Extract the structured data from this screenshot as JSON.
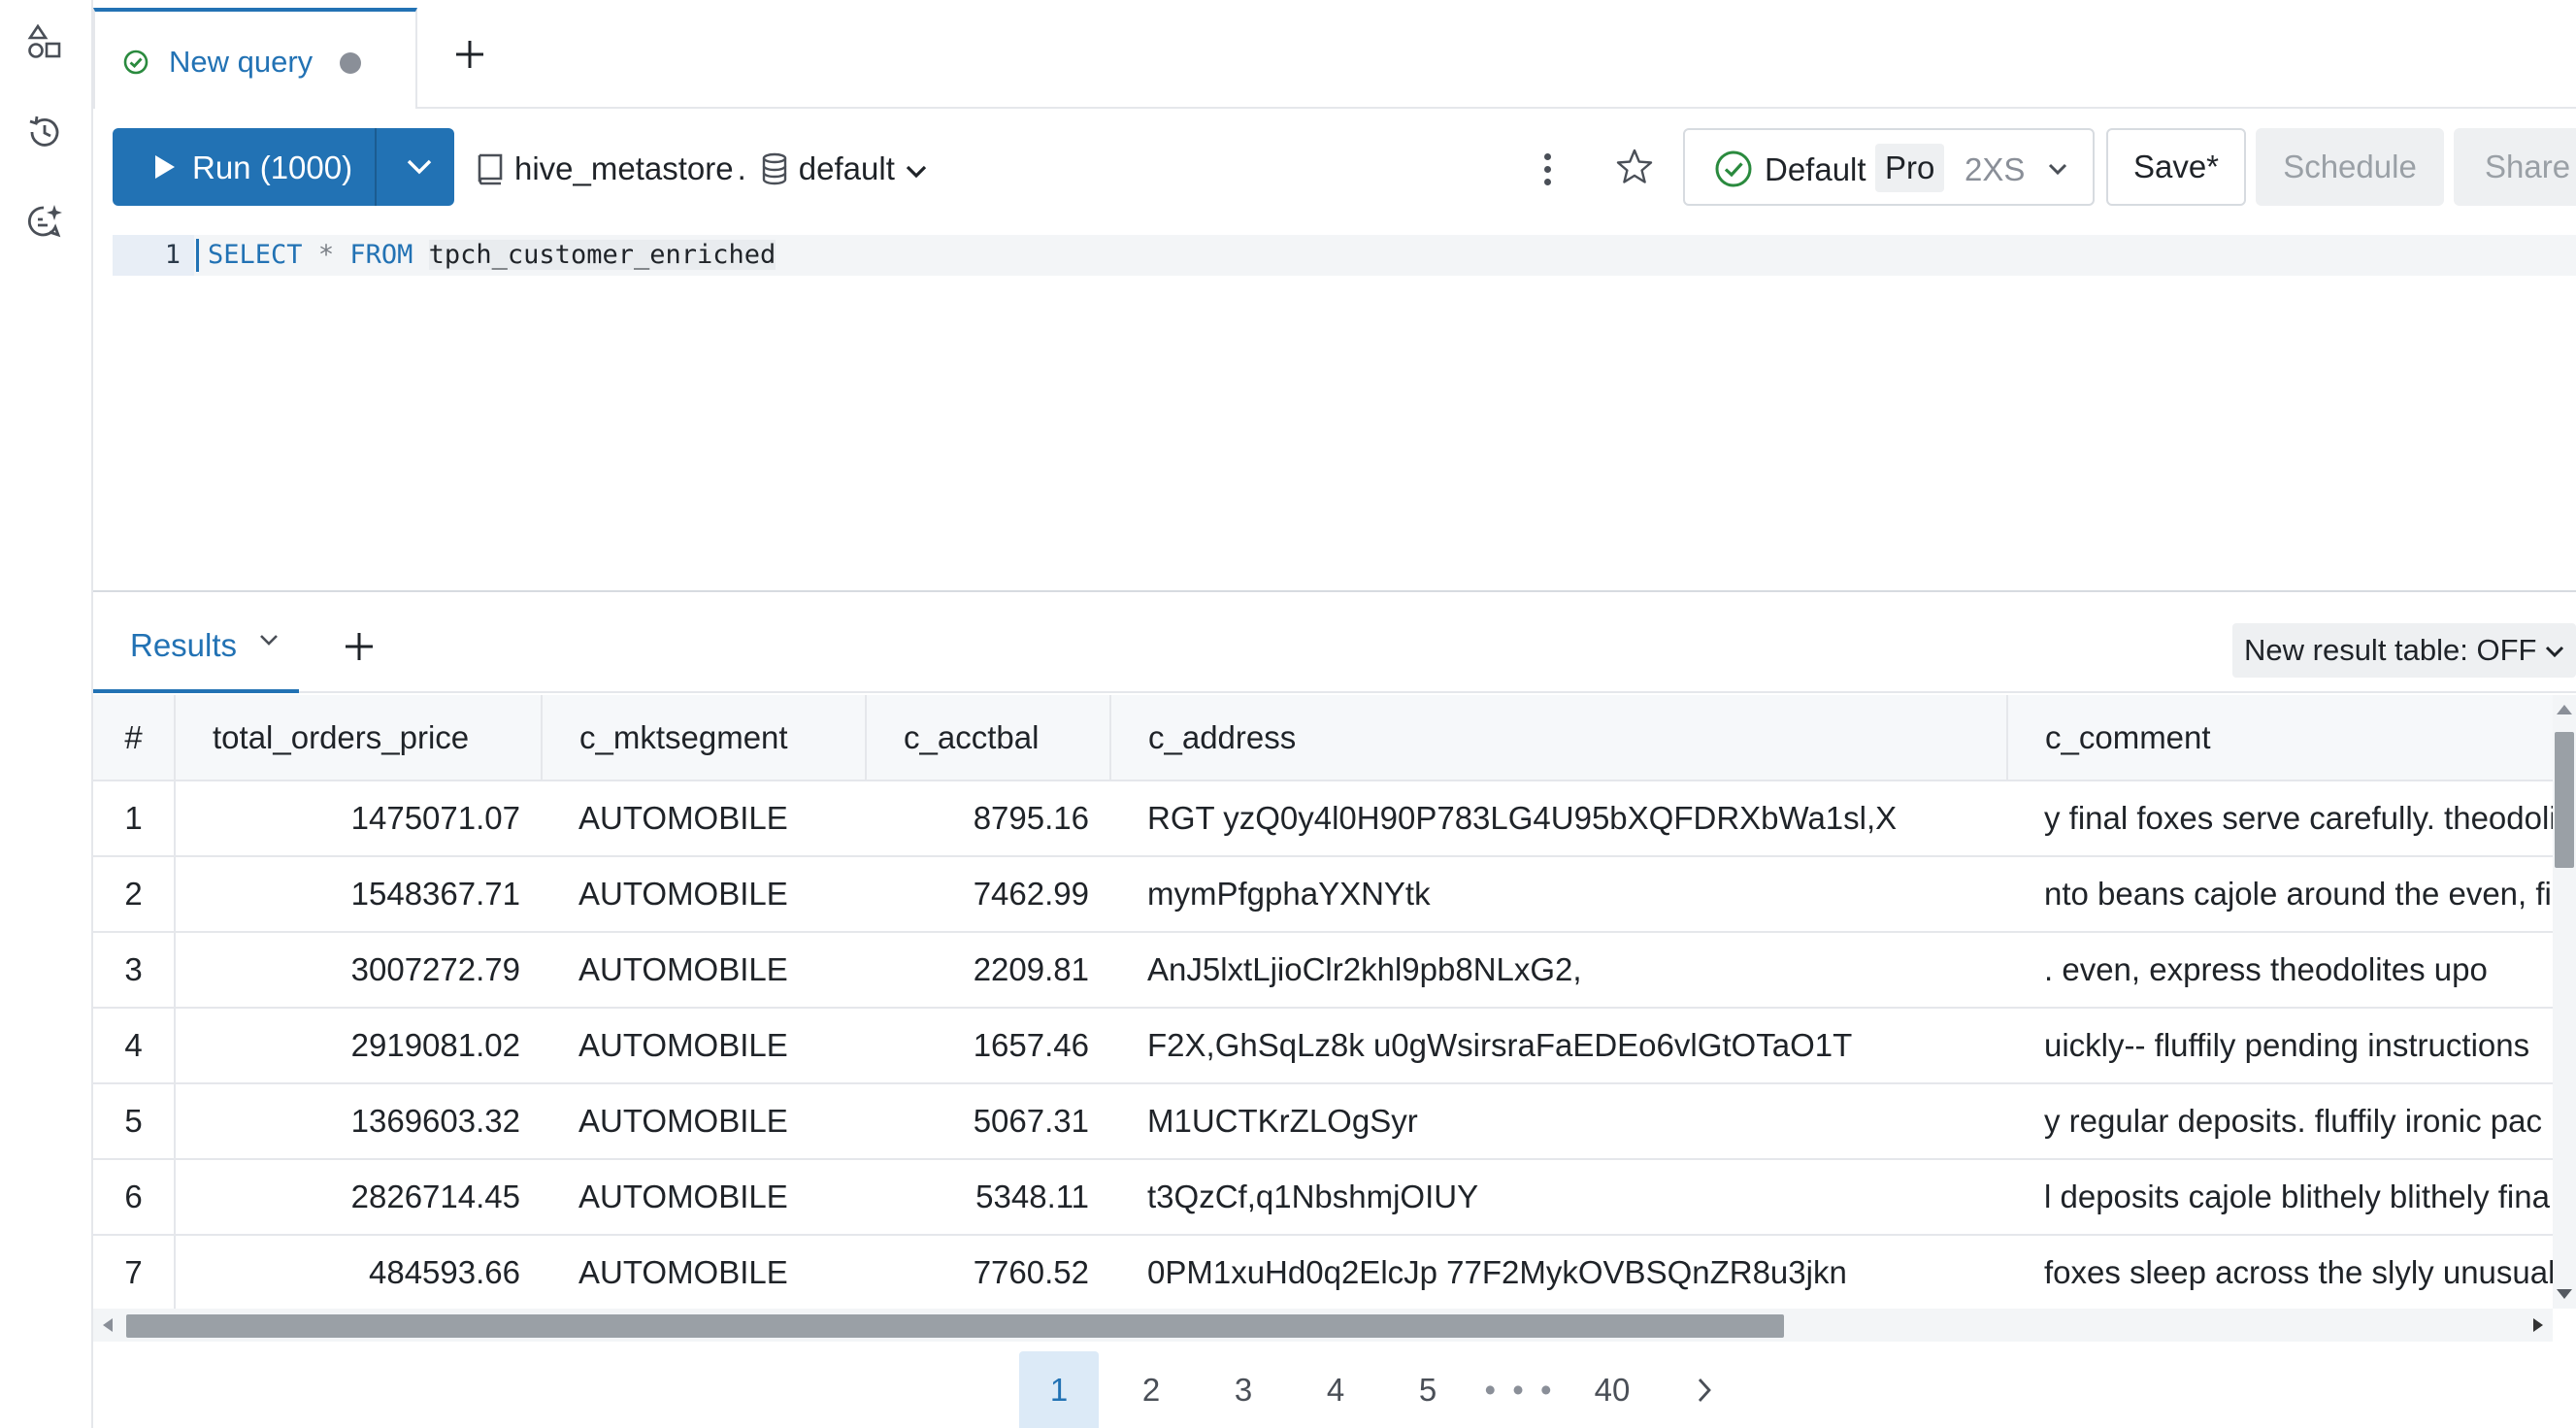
{
  "sidebar": {
    "icons": [
      "shapes-icon",
      "history-icon",
      "assistant-icon"
    ]
  },
  "tabs": {
    "items": [
      {
        "label": "New query",
        "unsaved": true
      }
    ],
    "add_label": "+"
  },
  "toolbar": {
    "run_label": "Run (1000)",
    "catalog": "hive_metastore",
    "separator": ".",
    "schema": "default",
    "warehouse": {
      "name": "Default",
      "tier": "Pro",
      "size": "2XS"
    },
    "save_label": "Save*",
    "schedule_label": "Schedule",
    "share_label": "Share"
  },
  "editor": {
    "line_number": "1",
    "tokens": {
      "kw1": "SELECT",
      "star": "*",
      "kw2": "FROM",
      "table": "tpch_customer_enriched"
    }
  },
  "results": {
    "tab_label": "Results",
    "add_label": "+",
    "new_result_table_label": "New result table: OFF",
    "columns": [
      "#",
      "total_orders_price",
      "c_mktsegment",
      "c_acctbal",
      "c_address",
      "c_comment"
    ],
    "rows": [
      [
        "1",
        "1475071.07",
        "AUTOMOBILE",
        "8795.16",
        "RGT yzQ0y4l0H90P783LG4U95bXQFDRXbWa1sl,X",
        "y final foxes serve carefully. theodolites"
      ],
      [
        "2",
        "1548367.71",
        "AUTOMOBILE",
        "7462.99",
        "mymPfgphaYXNYtk",
        "nto beans cajole around the even, fi"
      ],
      [
        "3",
        "3007272.79",
        "AUTOMOBILE",
        "2209.81",
        "AnJ5lxtLjioClr2khl9pb8NLxG2,",
        ". even, express theodolites upo"
      ],
      [
        "4",
        "2919081.02",
        "AUTOMOBILE",
        "1657.46",
        "F2X,GhSqLz8k u0gWsirsraFaEDEo6vlGtOTaO1T",
        "uickly-- fluffily pending instructions"
      ],
      [
        "5",
        "1369603.32",
        "AUTOMOBILE",
        "5067.31",
        "M1UCTKrZLOgSyr",
        "y regular deposits. fluffily ironic pac"
      ],
      [
        "6",
        "2826714.45",
        "AUTOMOBILE",
        "5348.11",
        "t3QzCf,q1NbshmjOIUY",
        "l deposits cajole blithely blithely fina"
      ],
      [
        "7",
        "484593.66",
        "AUTOMOBILE",
        "7760.52",
        "0PM1xuHd0q2ElcJp 77F2MykOVBSQnZR8u3jkn",
        "foxes sleep across the slyly unusual"
      ]
    ]
  },
  "pagination": {
    "pages": [
      "1",
      "2",
      "3",
      "4",
      "5"
    ],
    "ellipsis": "• • •",
    "last": "40",
    "current": "1",
    "next_label": ">"
  },
  "colors": {
    "accent": "#2272b4",
    "success": "#2a8a3e",
    "border": "#e5e7eb",
    "muted": "#8a8f98"
  }
}
